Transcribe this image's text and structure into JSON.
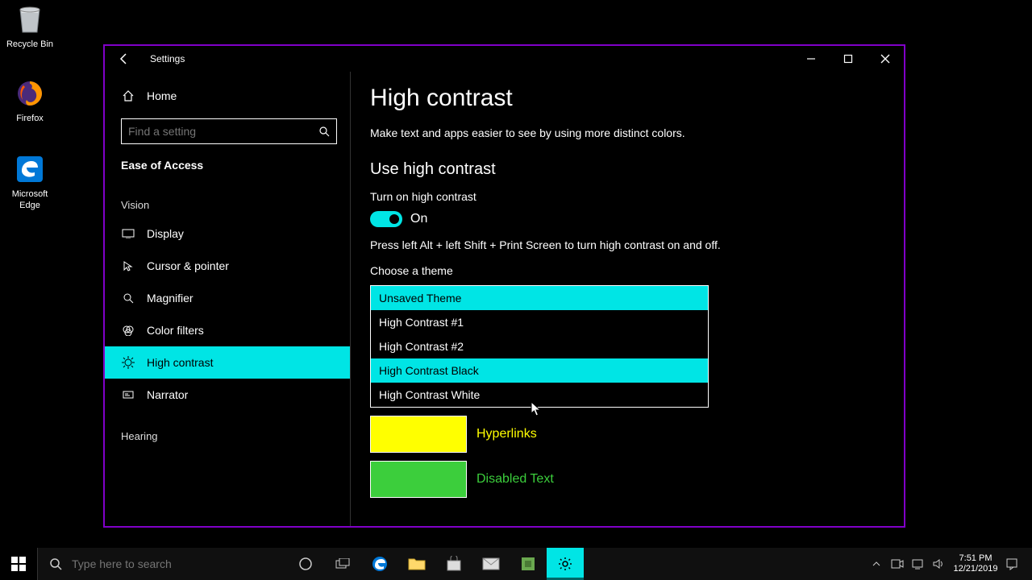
{
  "desktop": {
    "icons": [
      {
        "label": "Recycle Bin"
      },
      {
        "label": "Firefox"
      },
      {
        "label": "Microsoft Edge"
      }
    ]
  },
  "window": {
    "title": "Settings",
    "home": "Home",
    "search_placeholder": "Find a setting",
    "category": "Ease of Access",
    "group_vision": "Vision",
    "group_hearing": "Hearing",
    "nav": {
      "display": "Display",
      "cursor": "Cursor & pointer",
      "magnifier": "Magnifier",
      "color_filters": "Color filters",
      "high_contrast": "High contrast",
      "narrator": "Narrator"
    }
  },
  "page": {
    "heading": "High contrast",
    "desc": "Make text and apps easier to see by using more distinct colors.",
    "section": "Use high contrast",
    "toggle_label": "Turn on high contrast",
    "toggle_state": "On",
    "hint": "Press left Alt + left Shift + Print Screen to turn high contrast on and off.",
    "theme_label": "Choose a theme",
    "theme_options": {
      "unsaved": "Unsaved Theme",
      "hc1": "High Contrast #1",
      "hc2": "High Contrast #2",
      "hc_black": "High Contrast Black",
      "hc_white": "High Contrast White"
    },
    "rows": {
      "hyperlinks": "Hyperlinks",
      "disabled_text": "Disabled Text"
    }
  },
  "taskbar": {
    "search_placeholder": "Type here to search",
    "time": "7:51 PM",
    "date": "12/21/2019"
  }
}
